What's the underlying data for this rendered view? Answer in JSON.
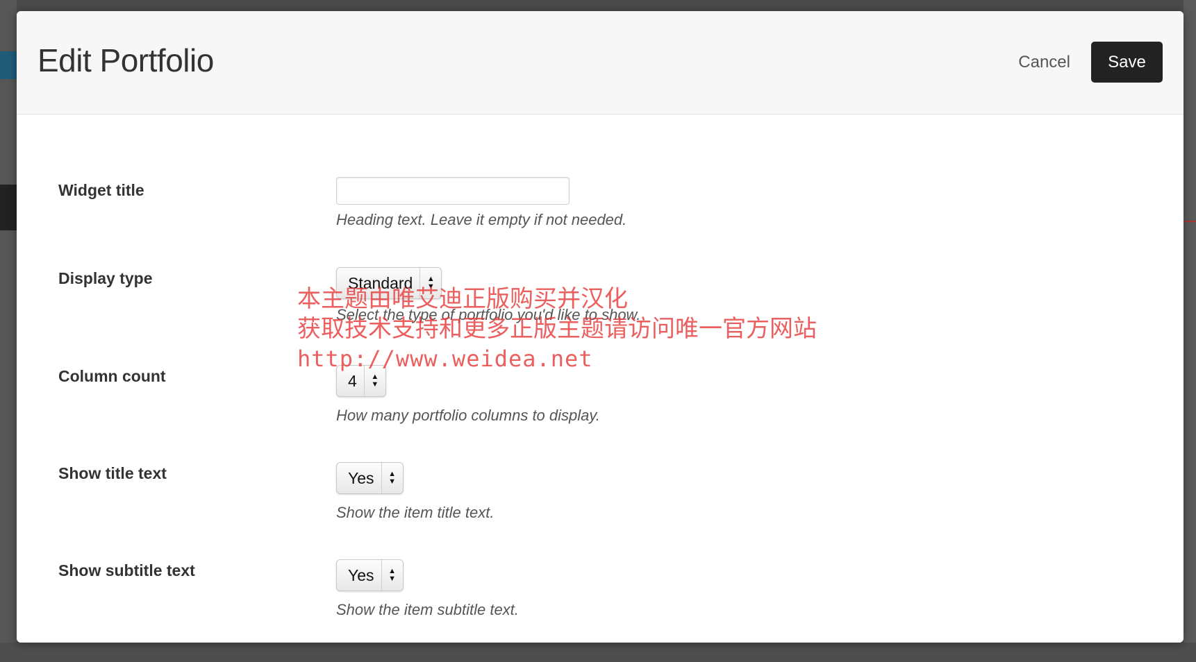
{
  "modal": {
    "title": "Edit Portfolio",
    "cancel_label": "Cancel",
    "save_label": "Save"
  },
  "fields": {
    "widget_title": {
      "label": "Widget title",
      "value": "",
      "help": "Heading text. Leave it empty if not needed."
    },
    "display_type": {
      "label": "Display type",
      "value": "Standard",
      "help": "Select the type of portfolio you'd like to show."
    },
    "column_count": {
      "label": "Column count",
      "value": "4",
      "help": "How many portfolio columns to display."
    },
    "show_title_text": {
      "label": "Show title text",
      "value": "Yes",
      "help": "Show the item title text."
    },
    "show_subtitle_text": {
      "label": "Show subtitle text",
      "value": "Yes",
      "help": "Show the item subtitle text."
    }
  },
  "watermark": {
    "line1": "本主题由唯艾迪正版购买并汉化",
    "line2": "获取技术支持和更多正版主题请访问唯一官方网站",
    "line3": "http://www.weidea.net"
  },
  "colors": {
    "save_bg": "#222222",
    "header_bg": "#f7f7f7",
    "watermark": "#e63c3c",
    "overlay": "#454545"
  }
}
